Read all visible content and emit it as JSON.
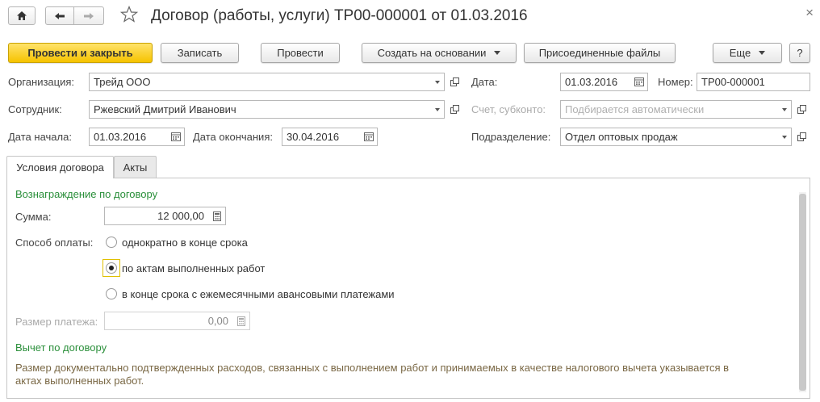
{
  "window": {
    "title": "Договор (работы, услуги) ТР00-000001 от 01.03.2016",
    "close_glyph": "×"
  },
  "toolbar": {
    "post_and_close": "Провести и закрыть",
    "save": "Записать",
    "post": "Провести",
    "create_based_on": "Создать на основании",
    "attached_files": "Присоединенные файлы",
    "more": "Еще",
    "help": "?"
  },
  "form": {
    "organization_label": "Организация:",
    "organization_value": "Трейд ООО",
    "employee_label": "Сотрудник:",
    "employee_value": "Ржевский Дмитрий Иванович",
    "start_date_label": "Дата начала:",
    "start_date_value": "01.03.2016",
    "end_date_label": "Дата окончания:",
    "end_date_value": "30.04.2016",
    "date_label": "Дата:",
    "date_value": "01.03.2016",
    "number_label": "Номер:",
    "number_value": "ТР00-000001",
    "account_label": "Счет, субконто:",
    "account_placeholder": "Подбирается автоматически",
    "department_label": "Подразделение:",
    "department_value": "Отдел оптовых продаж"
  },
  "tabs": [
    {
      "label": "Условия договора",
      "active": true
    },
    {
      "label": "Акты",
      "active": false
    }
  ],
  "terms": {
    "reward_section": "Вознаграждение по договору",
    "amount_label": "Сумма:",
    "amount_value": "12 000,00",
    "payment_method_label": "Способ оплаты:",
    "payment_options": [
      {
        "label": "однократно в конце срока",
        "selected": false
      },
      {
        "label": "по актам выполненных работ",
        "selected": true
      },
      {
        "label": "в конце срока с ежемесячными авансовыми платежами",
        "selected": false
      }
    ],
    "payment_size_label": "Размер платежа:",
    "payment_size_value": "0,00",
    "deduction_section": "Вычет по договору",
    "deduction_text": "Размер документально подтвержденных расходов, связанных с выполнением работ и принимаемых в качестве налогового вычета указывается в актах выполненных работ."
  },
  "colors": {
    "primary_button": "#f6c300",
    "section_green": "#2a8f3a",
    "description_brown": "#7a6845",
    "focus_yellow": "#e0c000"
  },
  "icons": [
    "home-icon",
    "back-arrow-icon",
    "forward-arrow-icon",
    "favorite-star-icon",
    "calendar-icon",
    "calculator-icon",
    "open-link-icon",
    "dropdown-icon",
    "close-icon"
  ]
}
